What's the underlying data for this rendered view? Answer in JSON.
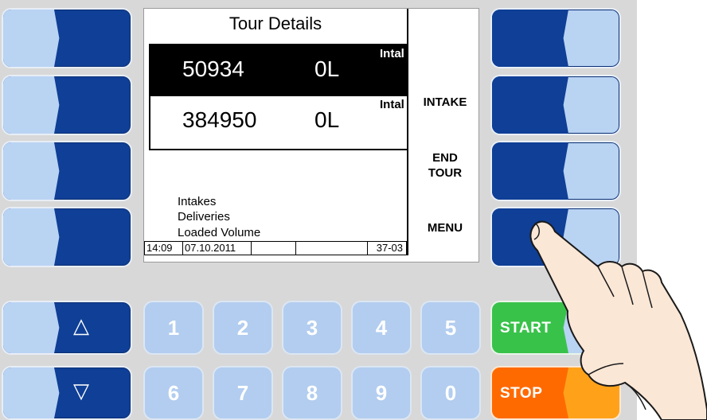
{
  "display": {
    "title": "Tour Details",
    "rows": [
      {
        "id": "50934",
        "volume": "0L",
        "type": "Intal",
        "selected": true
      },
      {
        "id": "384950",
        "volume": "0L",
        "type": "Intal",
        "selected": false
      }
    ],
    "softkeys": {
      "key2_label": "INTAKE",
      "key3_label_line1": "END",
      "key3_label_line2": "TOUR",
      "key4_label": "MENU"
    },
    "info_lines": [
      "Intakes",
      "Deliveries",
      "Loaded Volume"
    ],
    "statusbar": {
      "time": "14:09",
      "date": "07.10.2011",
      "field3": "",
      "field4": "",
      "code": "37-03"
    }
  },
  "keypad": {
    "digits_row1": [
      "1",
      "2",
      "3",
      "4",
      "5"
    ],
    "digits_row2": [
      "6",
      "7",
      "8",
      "9",
      "0"
    ],
    "up_glyph": "△",
    "down_glyph": "▽",
    "start_label": "START",
    "stop_label": "STOP"
  },
  "colors": {
    "key_dark_blue": "#0f3f96",
    "key_light_blue": "#b9d3f3",
    "start_green": "#39c24a",
    "stop_orange": "#ff6a00",
    "display_bg": "#ffffff"
  },
  "icons": [
    "pointing-hand-icon",
    "up-arrow-icon",
    "down-arrow-icon"
  ]
}
